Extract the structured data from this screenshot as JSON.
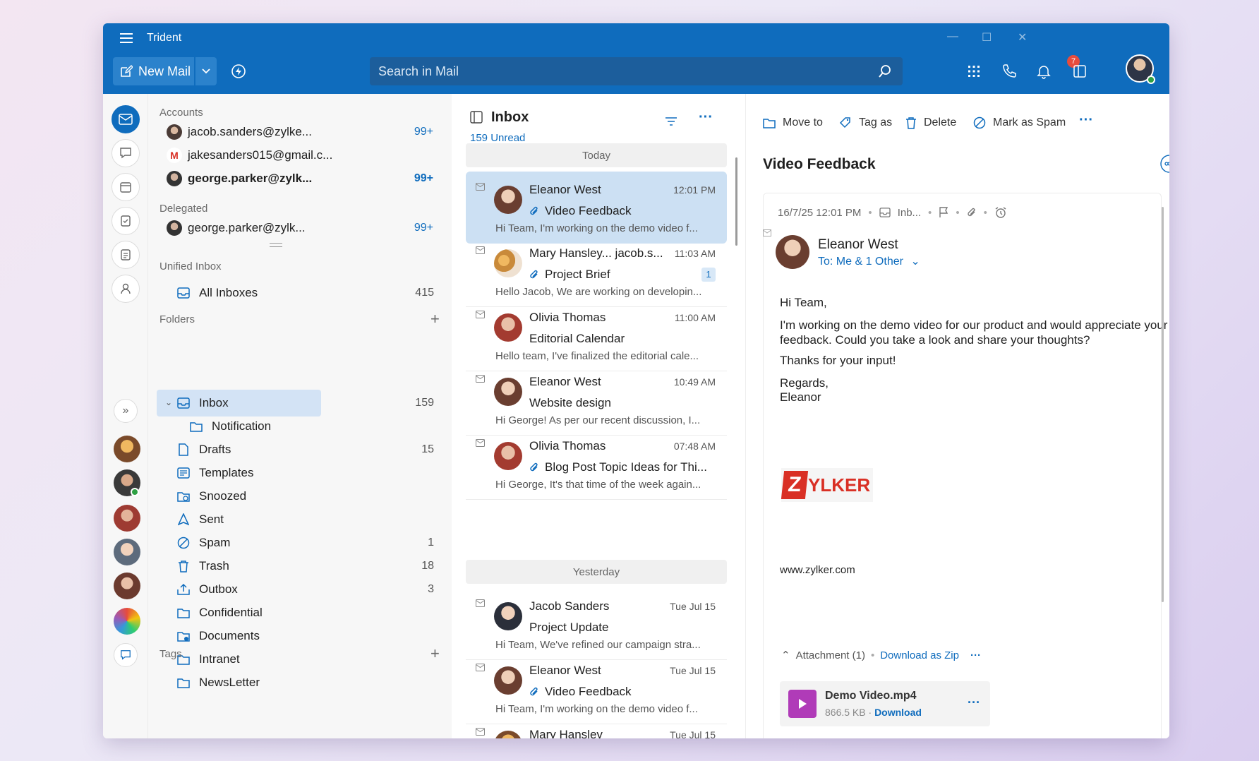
{
  "app": {
    "title": "Trident"
  },
  "toolbar": {
    "new_mail_label": "New Mail",
    "search_placeholder": "Search in Mail",
    "notification_count": "7"
  },
  "folders_pane": {
    "accounts_label": "Accounts",
    "accounts": [
      {
        "email": "jacob.sanders@zylke...",
        "count": "99+",
        "bold": false
      },
      {
        "email": "jakesanders015@gmail.c...",
        "count": "",
        "bold": false
      },
      {
        "email": "george.parker@zylk...",
        "count": "99+",
        "bold": true
      }
    ],
    "delegated_label": "Delegated",
    "delegated": [
      {
        "email": "george.parker@zylk...",
        "count": "99+"
      }
    ],
    "unified_label": "Unified Inbox",
    "all_inboxes": {
      "label": "All Inboxes",
      "count": "415"
    },
    "folders_label": "Folders",
    "folders": [
      {
        "label": "Inbox",
        "count": "159",
        "icon": "inbox-icon"
      },
      {
        "label": "Notification",
        "count": "",
        "icon": "folder-icon"
      },
      {
        "label": "Drafts",
        "count": "15",
        "icon": "draft-icon"
      },
      {
        "label": "Templates",
        "count": "",
        "icon": "template-icon"
      },
      {
        "label": "Snoozed",
        "count": "",
        "icon": "snooze-icon"
      },
      {
        "label": "Sent",
        "count": "",
        "icon": "sent-icon"
      },
      {
        "label": "Spam",
        "count": "1",
        "icon": "spam-icon"
      },
      {
        "label": "Trash",
        "count": "18",
        "icon": "trash-icon"
      },
      {
        "label": "Outbox",
        "count": "3",
        "icon": "outbox-icon"
      },
      {
        "label": "Confidential",
        "count": "",
        "icon": "folder-icon"
      },
      {
        "label": "Documents",
        "count": "",
        "icon": "shared-folder-icon"
      },
      {
        "label": "Intranet",
        "count": "",
        "icon": "folder-icon"
      },
      {
        "label": "NewsLetter",
        "count": "",
        "icon": "folder-icon"
      }
    ],
    "tags_label": "Tags"
  },
  "message_list": {
    "title": "Inbox",
    "unread": "159 Unread",
    "today_label": "Today",
    "yesterday_label": "Yesterday",
    "messages": [
      {
        "from": "Eleanor West",
        "time": "12:01 PM",
        "subject": "Video Feedback",
        "preview": "Hi Team, I'm working on the demo video f...",
        "attachment": true,
        "badge": ""
      },
      {
        "from": "Mary Hansley... jacob.s...",
        "time": "11:03 AM",
        "subject": "Project Brief",
        "preview": "Hello Jacob, We are working on developin...",
        "attachment": true,
        "badge": "1"
      },
      {
        "from": "Olivia Thomas",
        "time": "11:00 AM",
        "subject": "Editorial Calendar",
        "preview": "Hello team, I've finalized the editorial cale...",
        "attachment": false,
        "badge": ""
      },
      {
        "from": "Eleanor West",
        "time": "10:49 AM",
        "subject": "Website design",
        "preview": "Hi George! As per our recent discussion, I...",
        "attachment": false,
        "badge": ""
      },
      {
        "from": "Olivia Thomas",
        "time": "07:48 AM",
        "subject": "Blog Post Topic Ideas for Thi...",
        "preview": "Hi George, It's that time of the week again...",
        "attachment": true,
        "badge": ""
      },
      {
        "from": "Jacob Sanders",
        "time": "Tue Jul 15",
        "subject": "Project Update",
        "preview": "Hi Team, We've refined our campaign stra...",
        "attachment": false,
        "badge": ""
      },
      {
        "from": "Eleanor West",
        "time": "Tue Jul 15",
        "subject": "Video Feedback",
        "preview": "Hi Team, I'm working on the demo video f...",
        "attachment": true,
        "badge": ""
      },
      {
        "from": "Mary Hansley",
        "time": "Tue Jul 15",
        "subject": "",
        "preview": "",
        "attachment": false,
        "badge": ""
      }
    ]
  },
  "reader": {
    "actions": {
      "move_to": "Move to",
      "tag_as": "Tag as",
      "delete": "Delete",
      "mark_spam": "Mark as Spam"
    },
    "subject": "Video Feedback",
    "meta_date": "16/7/25 12:01 PM",
    "meta_folder": "Inb...",
    "sender": "Eleanor West",
    "to_line": "To: Me & 1 Other",
    "body": {
      "greeting": "Hi Team,",
      "para1": "I'm working on the demo video for our product and would appreciate your feedback. Could you take a look and share your thoughts?",
      "para2": "Thanks for your input!",
      "closing": "Regards,",
      "signature": "Eleanor",
      "logo_z": "Z",
      "logo_rest": "YLKER",
      "website": "www.zylker.com"
    },
    "attachment": {
      "label": "Attachment (1)",
      "zip_label": "Download as Zip",
      "file_name": "Demo Video.mp4",
      "file_size": "866.5 KB",
      "download_label": "Download"
    }
  },
  "colors": {
    "accent": "#0f6cbd",
    "selected": "#cce0f3",
    "logo_red": "#d93025"
  }
}
